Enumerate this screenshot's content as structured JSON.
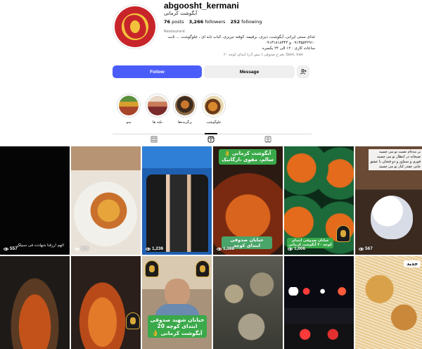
{
  "profile": {
    "username": "abgoosht_kermani",
    "full_name": "آبگوشت کرمانی",
    "stats": {
      "posts_count": "76",
      "posts_label": "posts",
      "followers_count": "3,266",
      "followers_label": "followers",
      "following_count": "252",
      "following_label": "following"
    },
    "category": "Restaurant",
    "bio_lines": [
      "غذای سنتی ایرانی، آبگوشت، دیزی، برقیمه، کوفته تبریزی، کباب تابه ای ، چلوگوشت ... ثابت",
      "۰۹۱۳۵۵۴۲۹۱۰ و ۰۹۱۳۱۸۱۸۳۴۴",
      "ساعات کاری : ۱۲ الی ۲۴ یکسره"
    ],
    "location": "قم خ صدوقی ( نبش آذر) ابتدای کوچه ۲۰, Qom, Iran"
  },
  "actions": {
    "follow": "Follow",
    "message": "Message",
    "suggest_icon": "person-add-icon"
  },
  "highlights": [
    {
      "label": "علوگوشت"
    },
    {
      "label": "پرگزیده‌ها"
    },
    {
      "label": "نکته ها"
    },
    {
      "label": "منو"
    }
  ],
  "tabs": [
    {
      "name": "posts",
      "icon": "grid-icon"
    },
    {
      "name": "reels",
      "icon": "reels-icon",
      "active": true
    },
    {
      "name": "tagged",
      "icon": "tagged-icon"
    }
  ],
  "grid": {
    "row1": [
      {
        "views": "557",
        "caption": "الهم ارزقنا شهادت فی سبیلک"
      },
      {
        "views": "605"
      },
      {
        "views": "1,236"
      },
      {
        "views": "1,388",
        "banner": "آبگوشت کرمانی 👌 سالم، مقوی ،ارگانیک",
        "banner2": "خیابان صدوقی ابتدای کوچه"
      },
      {
        "views": "1,006",
        "banner": "خیابان صدوقی ابتدای کوچه ۲۰ آبگوشت کرمانی"
      },
      {
        "views": "567",
        "caption_lines": [
          "بر بنده‌ام نعمت نو می چسید",
          "صبحانه در انتظار نو می چسید",
          "قوری و سماور و دو فنجان با عشق",
          "چایی چقدر کنار تو می چسید"
        ]
      }
    ],
    "row2": [
      {},
      {},
      {
        "banner_lines": [
          "خیابان شهید صدوقی",
          "ابتدای کوچه 20",
          "آبگوشت کرمانی 👌"
        ]
      },
      {},
      {},
      {
        "badge": "جدید"
      }
    ]
  },
  "colors": {
    "follow_blue": "#4a5df9",
    "green_banner": "#3aa94a"
  }
}
